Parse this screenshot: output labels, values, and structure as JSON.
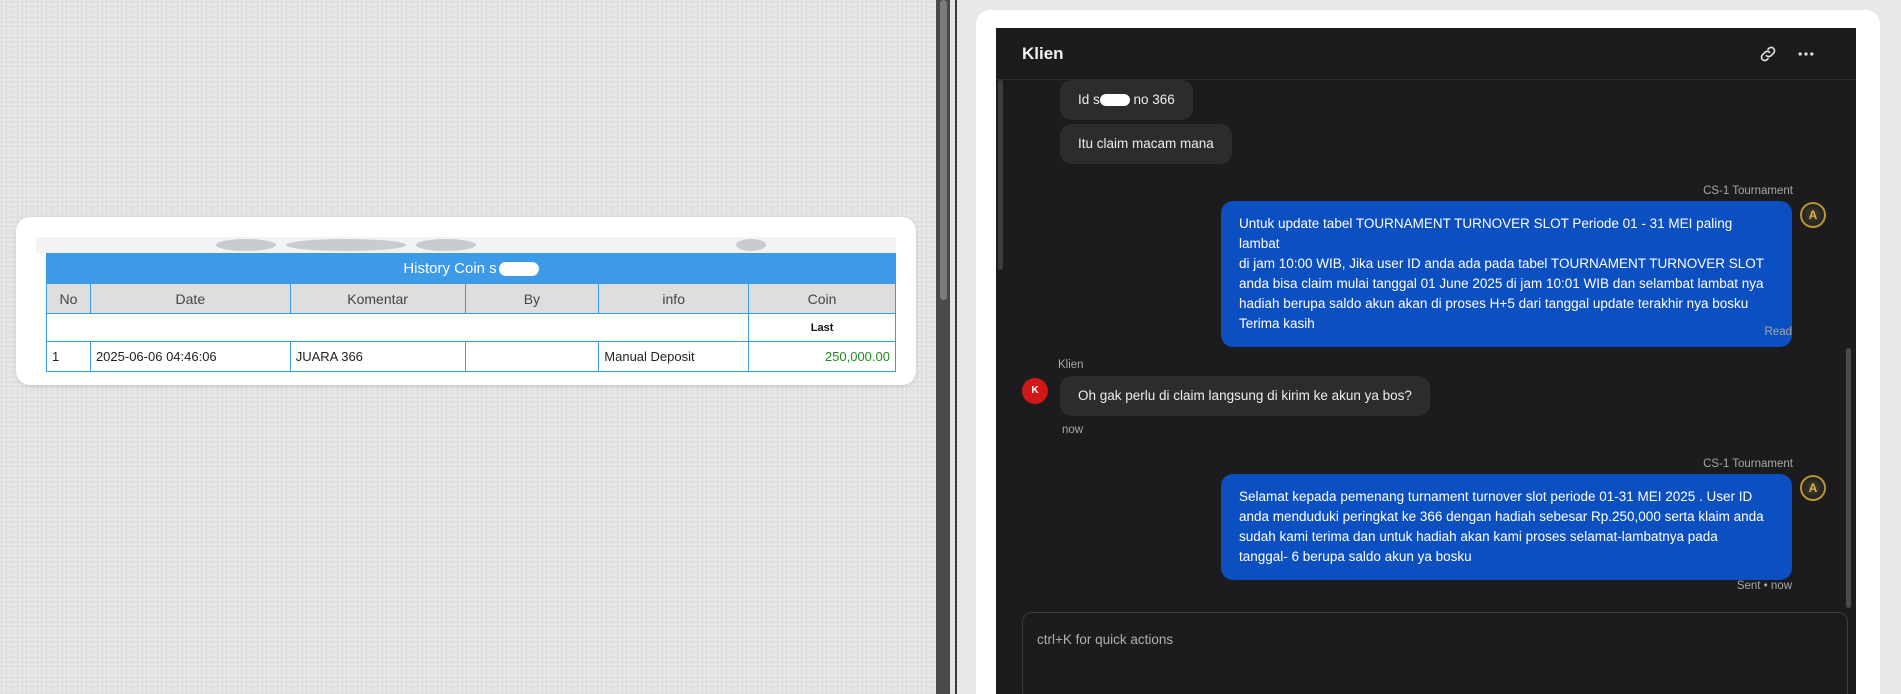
{
  "history": {
    "title": "History Coin s",
    "columns": [
      "No",
      "Date",
      "Komentar",
      "By",
      "info",
      "Coin"
    ],
    "sub_header": "Last",
    "rows": [
      {
        "no": "1",
        "date": "2025-06-06 04:46:06",
        "komentar": "JUARA 366",
        "by": "",
        "info": "Manual Deposit",
        "coin": "250,000.00"
      }
    ]
  },
  "chat": {
    "title": "Klien",
    "header_icons": [
      "link-icon",
      "more-icon"
    ],
    "messages_in_top": [
      {
        "text_a": "Id s",
        "text_b": " no 366"
      },
      {
        "text": "Itu claim macam mana"
      }
    ],
    "agent_1": {
      "sender": "CS-1 Tournament",
      "lines": [
        "Untuk update tabel TOURNAMENT TURNOVER SLOT Periode 01 - 31 MEI paling lambat",
        "di jam 10:00 WIB, Jika user ID anda ada pada tabel TOURNAMENT TURNOVER SLOT",
        "anda bisa claim mulai tanggal 01 June 2025 di jam 10:01 WIB dan selambat lambat nya",
        "hadiah berupa saldo akun akan di proses H+5 dari tanggal update terakhir nya bosku",
        "Terima kasih"
      ],
      "status": "Read",
      "avatar": "A"
    },
    "klien_msg": {
      "sender": "Klien",
      "avatar": "K",
      "text": "Oh gak perlu di claim langsung di kirim ke akun ya bos?",
      "time": "now"
    },
    "agent_2": {
      "sender": "CS-1 Tournament",
      "lines": [
        "Selamat kepada pemenang turnament turnover slot periode 01-31 MEI 2025 . User ID",
        "anda menduduki peringkat ke 366 dengan hadiah sebesar Rp.250,000 serta klaim anda",
        "sudah kami terima dan untuk hadiah akan kami proses selamat-lambatnya pada",
        "tanggal- 6 berupa saldo akun ya bosku"
      ],
      "status": "Sent • now",
      "avatar": "A"
    },
    "composer": {
      "placeholder": "ctrl+K for quick actions"
    }
  },
  "colors": {
    "table_blue": "#3c9ae6",
    "coin_green": "#1e8c1e",
    "chat_bg": "#1c1c1e",
    "bubble_out": "#0c4fc0",
    "klien_avatar": "#d01818"
  }
}
